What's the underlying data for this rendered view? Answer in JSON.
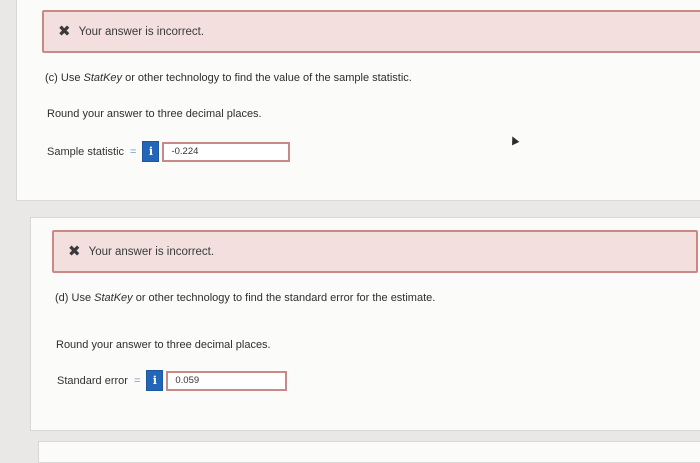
{
  "part_c": {
    "feedback": "Your answer is incorrect.",
    "question_prefix": "(c) Use ",
    "question_tool": "StatKey",
    "question_suffix": " or other technology to find the value of the sample statistic.",
    "instruction": "Round your answer to three decimal places.",
    "field_label": "Sample statistic",
    "equals": "=",
    "info_label": "i",
    "field_value": "-0.224"
  },
  "part_d": {
    "feedback": "Your answer is incorrect.",
    "question_prefix": "(d) Use ",
    "question_tool": "StatKey",
    "question_suffix": " or other technology to find the standard error for the estimate.",
    "instruction": "Round your answer to three decimal places.",
    "field_label": "Standard error",
    "equals": "=",
    "info_label": "i",
    "field_value": "0.059"
  },
  "icons": {
    "incorrect": "x-mark-icon",
    "info": "info-icon"
  }
}
